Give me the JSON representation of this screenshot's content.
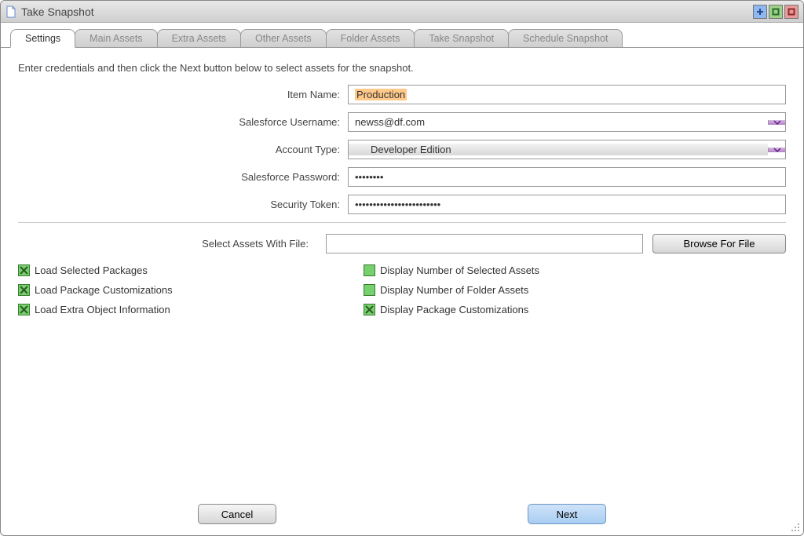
{
  "window": {
    "title": "Take Snapshot"
  },
  "tabs": [
    {
      "label": "Settings",
      "active": true
    },
    {
      "label": "Main Assets",
      "active": false
    },
    {
      "label": "Extra Assets",
      "active": false
    },
    {
      "label": "Other Assets",
      "active": false
    },
    {
      "label": "Folder Assets",
      "active": false
    },
    {
      "label": "Take Snapshot",
      "active": false
    },
    {
      "label": "Schedule Snapshot",
      "active": false
    }
  ],
  "instructions": "Enter credentials and then click the Next button below to select assets for the snapshot.",
  "form": {
    "item_name": {
      "label": "Item Name:",
      "value": "Production"
    },
    "username": {
      "label": "Salesforce Username:",
      "value": "newss@df.com"
    },
    "account_type": {
      "label": "Account Type:",
      "value": "Developer Edition"
    },
    "password": {
      "label": "Salesforce Password:",
      "value": "••••••••"
    },
    "security_token": {
      "label": "Security Token:",
      "value": "••••••••••••••••••••••••"
    }
  },
  "file_select": {
    "label": "Select Assets With File:",
    "value": "",
    "browse_label": "Browse For File"
  },
  "options_left": [
    {
      "label": "Load Selected Packages",
      "checked": true
    },
    {
      "label": "Load Package Customizations",
      "checked": true
    },
    {
      "label": "Load Extra Object Information",
      "checked": true
    }
  ],
  "options_right": [
    {
      "label": "Display Number of Selected Assets",
      "checked": false
    },
    {
      "label": "Display Number of Folder Assets",
      "checked": false
    },
    {
      "label": "Display Package Customizations",
      "checked": true
    }
  ],
  "footer": {
    "cancel_label": "Cancel",
    "next_label": "Next"
  }
}
